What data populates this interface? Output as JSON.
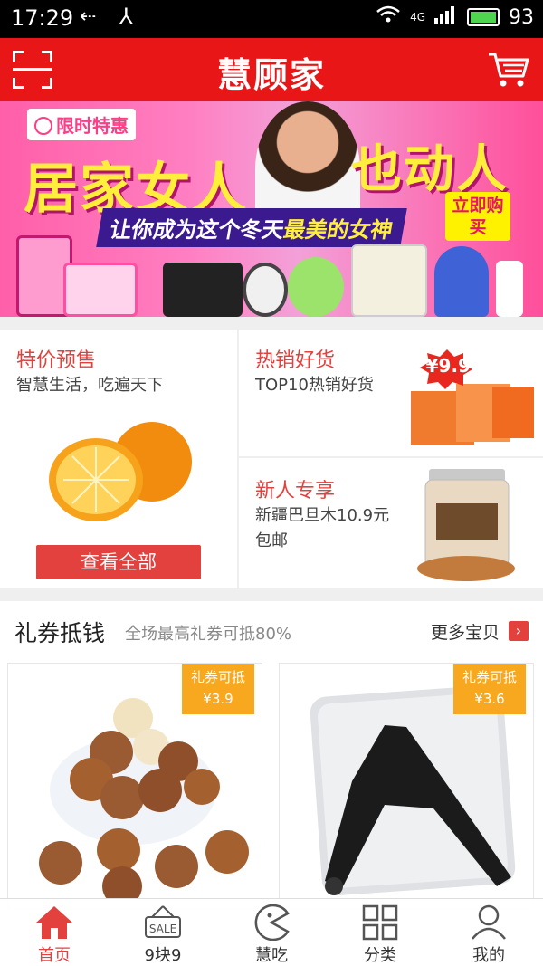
{
  "status_bar": {
    "time": "17:29",
    "network": "4G",
    "battery": "93"
  },
  "header": {
    "title": "慧顾家",
    "scan_icon": "scan-icon",
    "cart_icon": "cart-icon"
  },
  "banner": {
    "limited_badge": "限时特惠",
    "headline_left": "居家女人",
    "headline_right": "也动人",
    "subline_prefix": "让你成为这个冬天",
    "subline_highlight": "最美的女神",
    "buy_button": "立即购买"
  },
  "promo": {
    "left": {
      "title": "特价预售",
      "desc": "智慧生活，吃遍天下",
      "button": "查看全部"
    },
    "right_top": {
      "title": "热销好货",
      "desc": "TOP10热销好货",
      "price_tag": "¥9.9"
    },
    "right_bottom": {
      "title": "新人专享",
      "desc": "新疆巴旦木10.9元包邮"
    }
  },
  "coupon_section": {
    "title": "礼券抵钱",
    "subtitle": "全场最高礼券可抵80%",
    "more": "更多宝贝",
    "items": [
      {
        "tag_label": "礼券可抵",
        "tag_value": "¥3.9"
      },
      {
        "tag_label": "礼券可抵",
        "tag_value": "¥3.6"
      }
    ]
  },
  "tabbar": {
    "items": [
      {
        "label": "首页",
        "icon": "home-icon"
      },
      {
        "label": "9块9",
        "icon": "sale-icon",
        "icon_text": "SALE"
      },
      {
        "label": "慧吃",
        "icon": "pacman-icon"
      },
      {
        "label": "分类",
        "icon": "grid-icon"
      },
      {
        "label": "我的",
        "icon": "user-icon"
      }
    ]
  },
  "colors": {
    "brand_red": "#e81616",
    "accent_red": "#e2413e",
    "tag_orange": "#f7a81e"
  }
}
